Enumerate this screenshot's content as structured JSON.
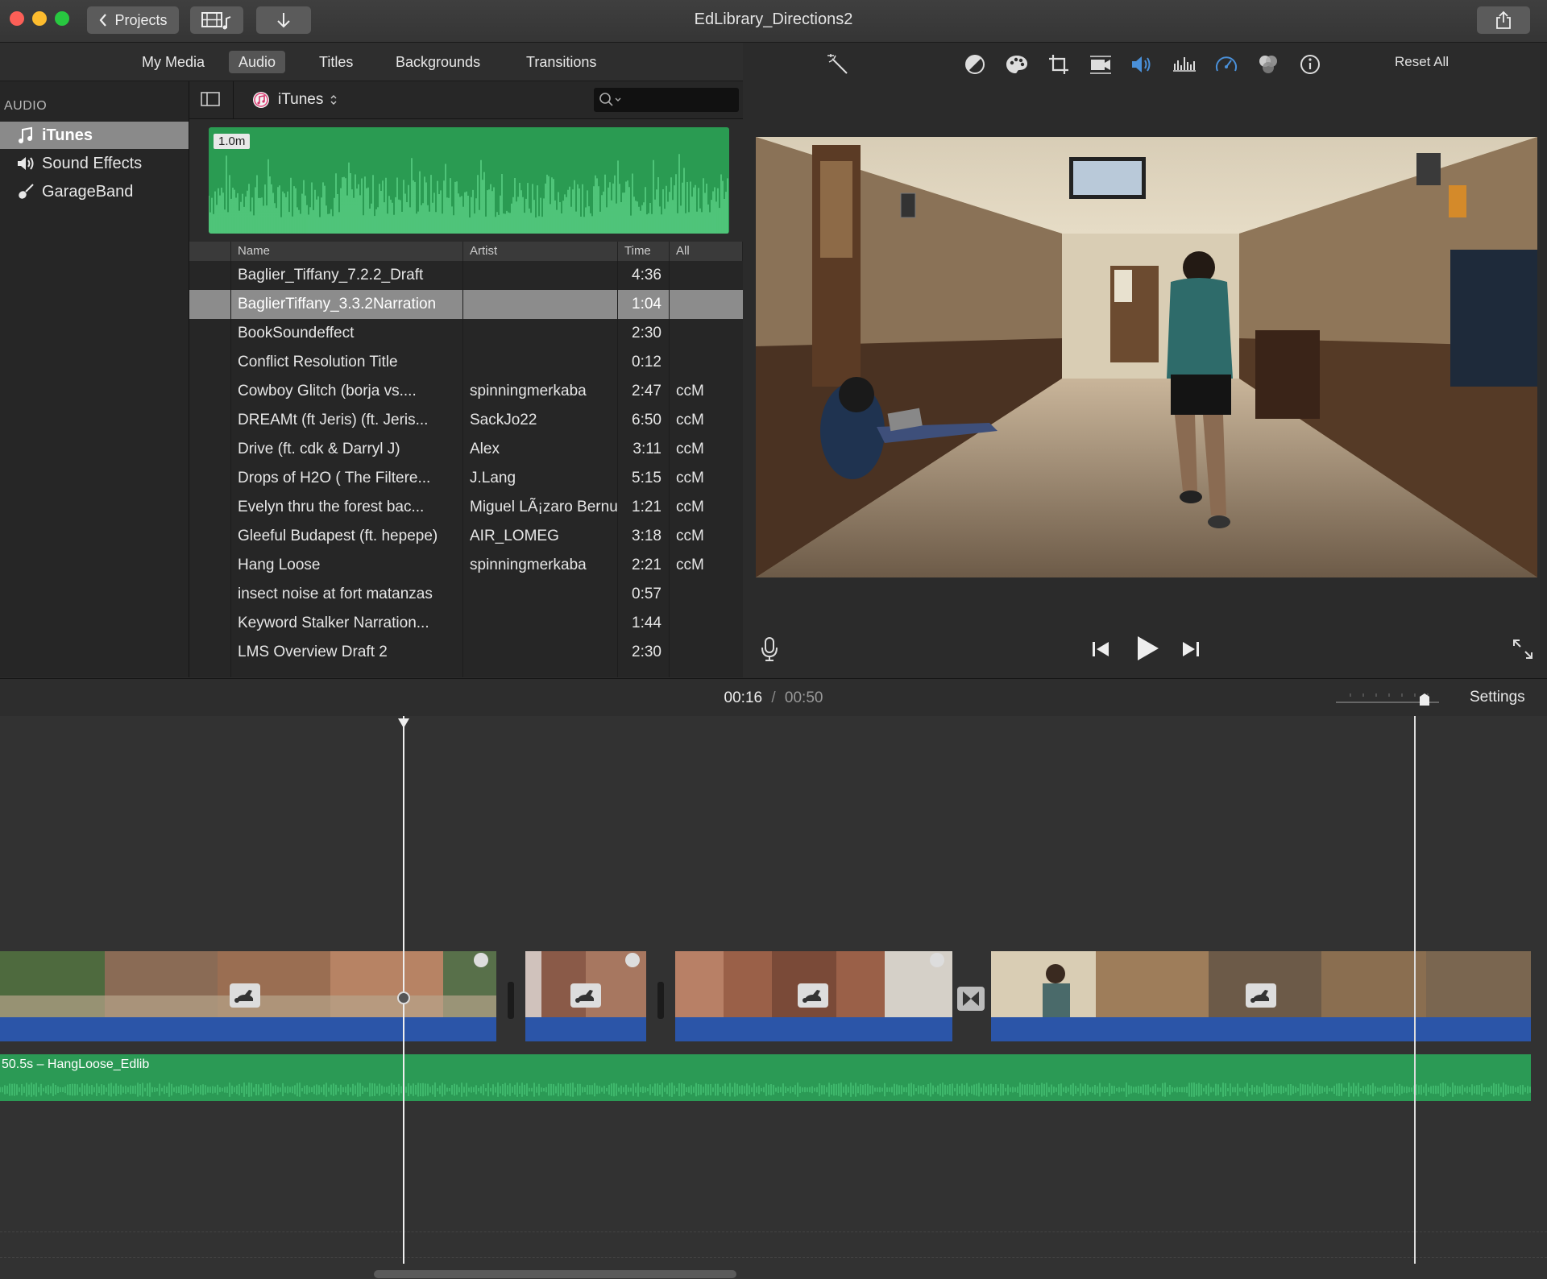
{
  "window": {
    "title": "EdLibrary_Directions2",
    "projects_label": "Projects"
  },
  "tabs": [
    {
      "label": "My Media"
    },
    {
      "label": "Audio"
    },
    {
      "label": "Titles"
    },
    {
      "label": "Backgrounds"
    },
    {
      "label": "Transitions"
    }
  ],
  "sidebar": {
    "heading": "AUDIO",
    "items": [
      {
        "label": "iTunes",
        "icon": "music-note-icon"
      },
      {
        "label": "Sound Effects",
        "icon": "speaker-icon"
      },
      {
        "label": "GarageBand",
        "icon": "guitar-icon"
      }
    ]
  },
  "browser": {
    "source_label": "iTunes",
    "search_placeholder": "",
    "preview_duration": "1.0m"
  },
  "table": {
    "columns": [
      "Name",
      "Artist",
      "Time",
      "All"
    ],
    "rows": [
      {
        "name": "Baglier_Tiffany_7.2.2_Draft",
        "artist": "",
        "time": "4:36",
        "album": ""
      },
      {
        "name": "BaglierTiffany_3.3.2Narration",
        "artist": "",
        "time": "1:04",
        "album": ""
      },
      {
        "name": "BookSoundeffect",
        "artist": "",
        "time": "2:30",
        "album": ""
      },
      {
        "name": "Conflict Resolution Title",
        "artist": "",
        "time": "0:12",
        "album": ""
      },
      {
        "name": "Cowboy Glitch (borja vs....",
        "artist": "spinningmerkaba",
        "time": "2:47",
        "album": "ccM"
      },
      {
        "name": "DREAMt (ft Jeris) (ft. Jeris...",
        "artist": "SackJo22",
        "time": "6:50",
        "album": "ccM"
      },
      {
        "name": "Drive (ft. cdk & Darryl J)",
        "artist": "Alex",
        "time": "3:11",
        "album": "ccM"
      },
      {
        "name": "Drops of H2O ( The Filtere...",
        "artist": "J.Lang",
        "time": "5:15",
        "album": "ccM"
      },
      {
        "name": "Evelyn thru the forest bac...",
        "artist": "Miguel LÃ¡zaro Bernuy",
        "time": "1:21",
        "album": "ccM"
      },
      {
        "name": "Gleeful Budapest (ft. hepepe)",
        "artist": "AIR_LOMEG",
        "time": "3:18",
        "album": "ccM"
      },
      {
        "name": "Hang Loose",
        "artist": "spinningmerkaba",
        "time": "2:21",
        "album": "ccM"
      },
      {
        "name": "insect noise at fort matanzas",
        "artist": "",
        "time": "0:57",
        "album": ""
      },
      {
        "name": "Keyword Stalker Narration...",
        "artist": "",
        "time": "1:44",
        "album": ""
      },
      {
        "name": "LMS Overview Draft 2",
        "artist": "",
        "time": "2:30",
        "album": ""
      }
    ],
    "selected_index": 1
  },
  "viewer": {
    "reset_label": "Reset All"
  },
  "timeline": {
    "current_time": "00:16",
    "separator": "/",
    "total_time": "00:50",
    "settings_label": "Settings",
    "audio_clip_label": "50.5s – HangLoose_Edlib"
  },
  "colors": {
    "accent_blue": "#4a90d9",
    "audio_green": "#2b9a55",
    "clip_blue": "#2b55a8",
    "close": "#fc5f57",
    "minimize": "#fdbc2e",
    "zoom": "#28c840"
  }
}
